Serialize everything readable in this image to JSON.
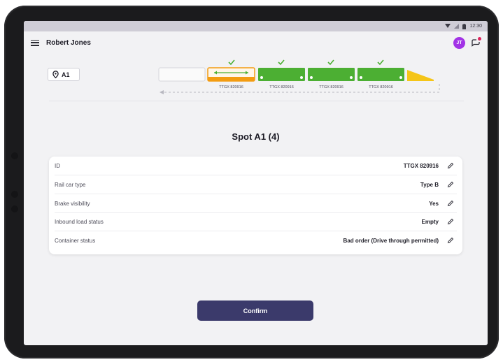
{
  "status_bar": {
    "time": "12:30"
  },
  "app_bar": {
    "user_name": "Robert Jones",
    "avatar_initials": "JT"
  },
  "location": {
    "label": "A1"
  },
  "train": {
    "cars": [
      {
        "id": "",
        "state": "empty-outline",
        "check": false
      },
      {
        "id": "TTGX 820916",
        "state": "selected",
        "check": true
      },
      {
        "id": "TTGX 820916",
        "state": "complete",
        "check": true
      },
      {
        "id": "TTGX 820916",
        "state": "complete",
        "check": true
      },
      {
        "id": "TTGX 820916",
        "state": "complete",
        "check": true
      }
    ],
    "colors": {
      "selected": "#f39c12",
      "complete": "#4caf33",
      "empty": "#e6e6ea",
      "check": "#4caf33",
      "locomotive": "#f5c518"
    }
  },
  "spot": {
    "title": "Spot A1 (4)"
  },
  "details": [
    {
      "label": "ID",
      "value": "TTGX 820916"
    },
    {
      "label": "Rail car type",
      "value": "Type B"
    },
    {
      "label": "Brake visibility",
      "value": "Yes"
    },
    {
      "label": "Inbound load status",
      "value": "Empty"
    },
    {
      "label": "Container status",
      "value": "Bad order (Drive through permitted)"
    }
  ],
  "confirm": {
    "label": "Confirm"
  },
  "colors": {
    "primary": "#3b3a6b",
    "avatar": "#a233e6",
    "notification": "#e0245e"
  }
}
